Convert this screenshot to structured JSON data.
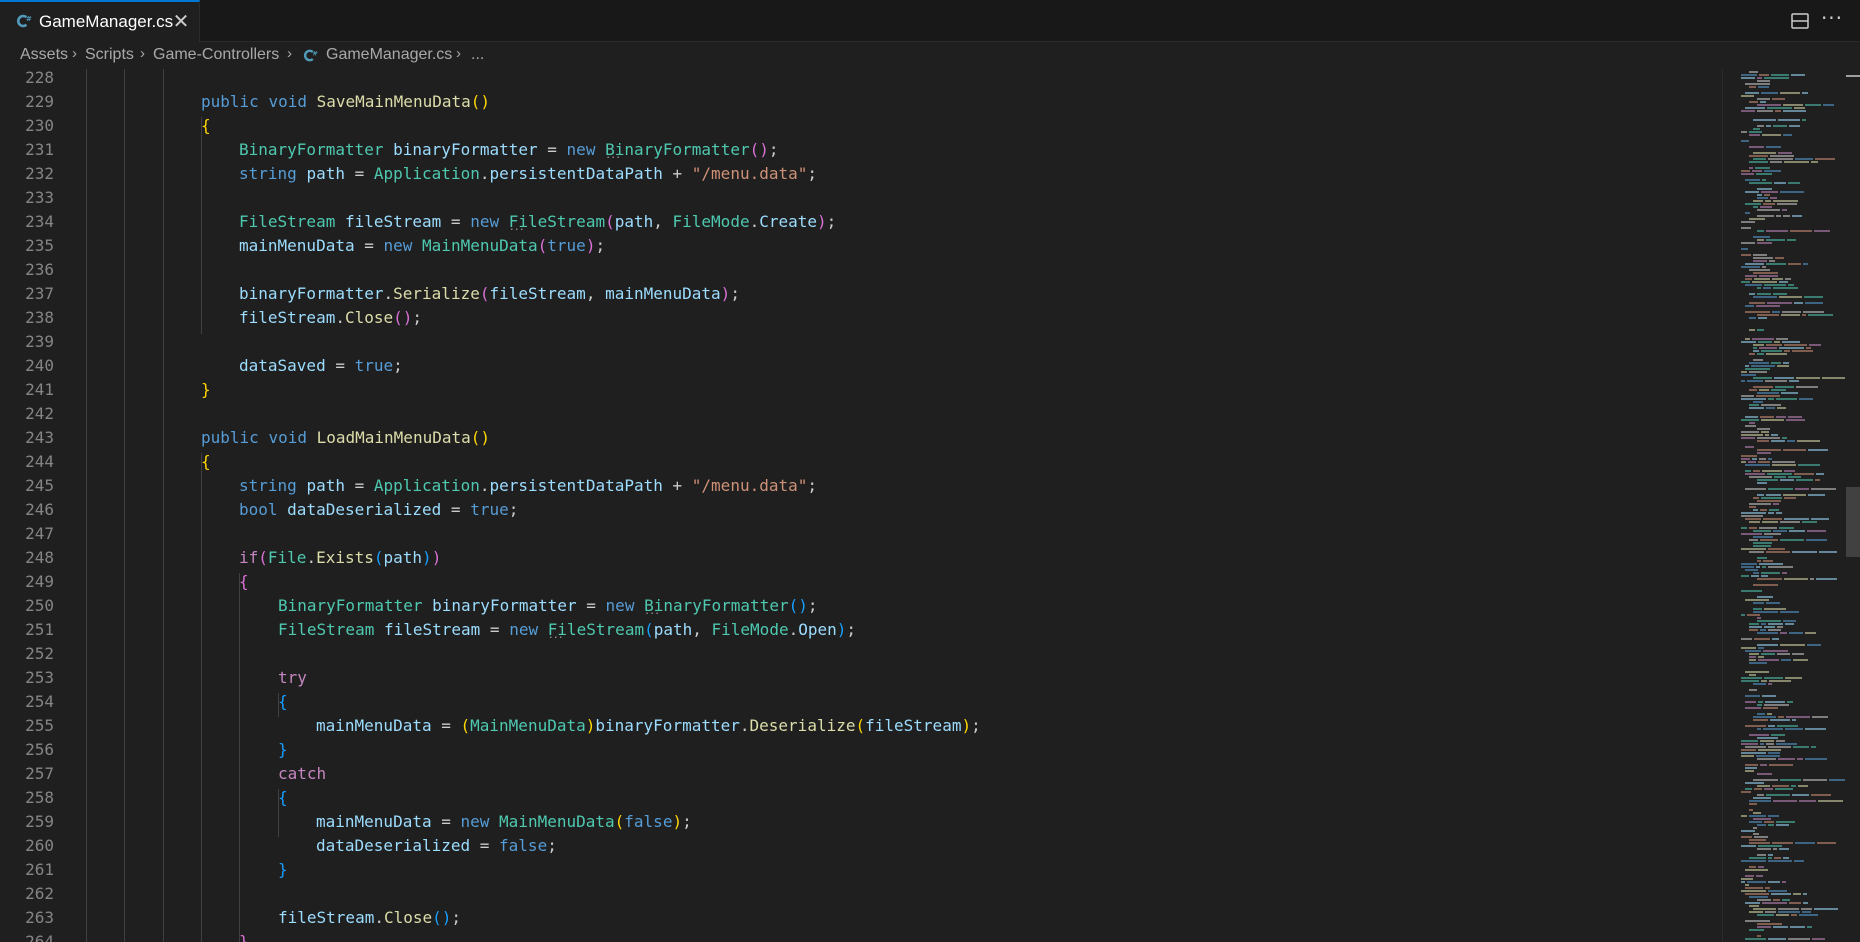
{
  "tab": {
    "title": "GameManager.cs",
    "close_glyph": "✕"
  },
  "toolbar": {
    "more_glyph": "···"
  },
  "breadcrumb": {
    "items": [
      "Assets",
      "Scripts",
      "Game-Controllers",
      "GameManager.cs",
      "..."
    ],
    "separator": "›"
  },
  "colors": {
    "accent": "#0078d4",
    "keyword": "#569cd6",
    "control": "#c586c0",
    "type": "#4ec9b0",
    "function": "#dcdcaa",
    "variable": "#9cdcfe",
    "string": "#ce9178",
    "csharp_icon": "#519aba"
  },
  "editor": {
    "line_numbers": [
      "228",
      "229",
      "230",
      "231",
      "232",
      "233",
      "234",
      "235",
      "236",
      "237",
      "238",
      "239",
      "240",
      "241",
      "242",
      "243",
      "244",
      "245",
      "246",
      "247",
      "248",
      "249",
      "250",
      "251",
      "252",
      "253",
      "254",
      "255",
      "256",
      "257",
      "258",
      "259",
      "260",
      "261",
      "262",
      "263",
      "264"
    ],
    "text": {
      "public": "public",
      "void": "void",
      "string": "string",
      "bool": "bool",
      "new": "new",
      "true": "true",
      "false": "false",
      "if": "if",
      "try": "try",
      "catch": "catch",
      "save_method": "SaveMainMenuData",
      "load_method": "LoadMainMenuData",
      "BinaryFormatter": "BinaryFormatter",
      "binaryFormatter": "binaryFormatter",
      "FileStream": "FileStream",
      "fileStream": "fileStream",
      "path": "path",
      "Application": "Application",
      "persistentDataPath": "persistentDataPath",
      "menu_data": "\"/menu.data\"",
      "FileMode": "FileMode",
      "Create": "Create",
      "Open": "Open",
      "mainMenuData": "mainMenuData",
      "MainMenuData": "MainMenuData",
      "Serialize": "Serialize",
      "Deserialize": "Deserialize",
      "Close": "Close",
      "dataSaved": "dataSaved",
      "dataDeserialized": "dataDeserialized",
      "File": "File",
      "Exists": "Exists"
    }
  }
}
